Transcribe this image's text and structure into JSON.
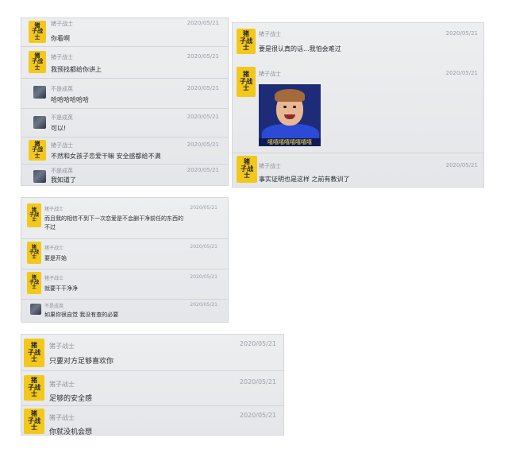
{
  "username": "猪子战士",
  "avatar_label": "猪\n子战\n士",
  "panels": [
    {
      "messages": [
        {
          "avatar": "yellow",
          "name": "猪子战士",
          "time": "2020/05/21",
          "text": "你看啊"
        },
        {
          "avatar": "yellow",
          "name": "猪子战士",
          "time": "2020/05/21",
          "text": "我预找都给你讲上"
        },
        {
          "avatar": "photo",
          "name": "不是成英",
          "time": "2020/05/21",
          "text": "哈哈哈哈哈哈"
        },
        {
          "avatar": "photo",
          "name": "不是成英",
          "time": "2020/05/21",
          "text": "可以!"
        },
        {
          "avatar": "yellow",
          "name": "猪子战士",
          "time": "2020/05/21",
          "text": "不然和女孩子恋爱干嘛 安全感都给不满"
        },
        {
          "avatar": "photo",
          "name": "不是成英",
          "time": "2020/05/21",
          "text": "我知道了"
        }
      ]
    },
    {
      "messages": [
        {
          "avatar": "yellow",
          "name": "猪子战士",
          "time": "2020/05/21",
          "text": "要是很认真的话...我怕会难过"
        },
        {
          "avatar": "yellow",
          "name": "猪子战士",
          "time": "2020/05/21",
          "text": "",
          "meme_caption": "嘻嘻嘻嘻嘻嘻嘻嘻"
        },
        {
          "avatar": "yellow",
          "name": "猪子战士",
          "time": "2020/05/21",
          "text": "事实证明也是这样 之前有教训了"
        }
      ]
    },
    {
      "messages": [
        {
          "avatar": "yellow",
          "name": "猪子战士",
          "time": "2020/05/21",
          "text": "而且我的相信不到下一次恋爱是不会删干净前任的东西的 不过"
        },
        {
          "avatar": "yellow",
          "name": "猪子战士",
          "time": "2020/05/21",
          "text": "要是开始"
        },
        {
          "avatar": "yellow",
          "name": "猪子战士",
          "time": "2020/05/21",
          "text": "就要干干净净"
        },
        {
          "avatar": "photo",
          "name": "不是成英",
          "time": "2020/05/21",
          "text": "如果你很自觉 我没有查的必要"
        }
      ]
    },
    {
      "messages": [
        {
          "avatar": "yellow",
          "name": "猪子战士",
          "time": "2020/05/21",
          "text": "只要对方足够喜欢你"
        },
        {
          "avatar": "yellow",
          "name": "猪子战士",
          "time": "2020/05/21",
          "text": "足够的安全感"
        },
        {
          "avatar": "yellow",
          "name": "猪子战士",
          "time": "2020/05/21",
          "text": "你就没机会想"
        }
      ]
    }
  ]
}
